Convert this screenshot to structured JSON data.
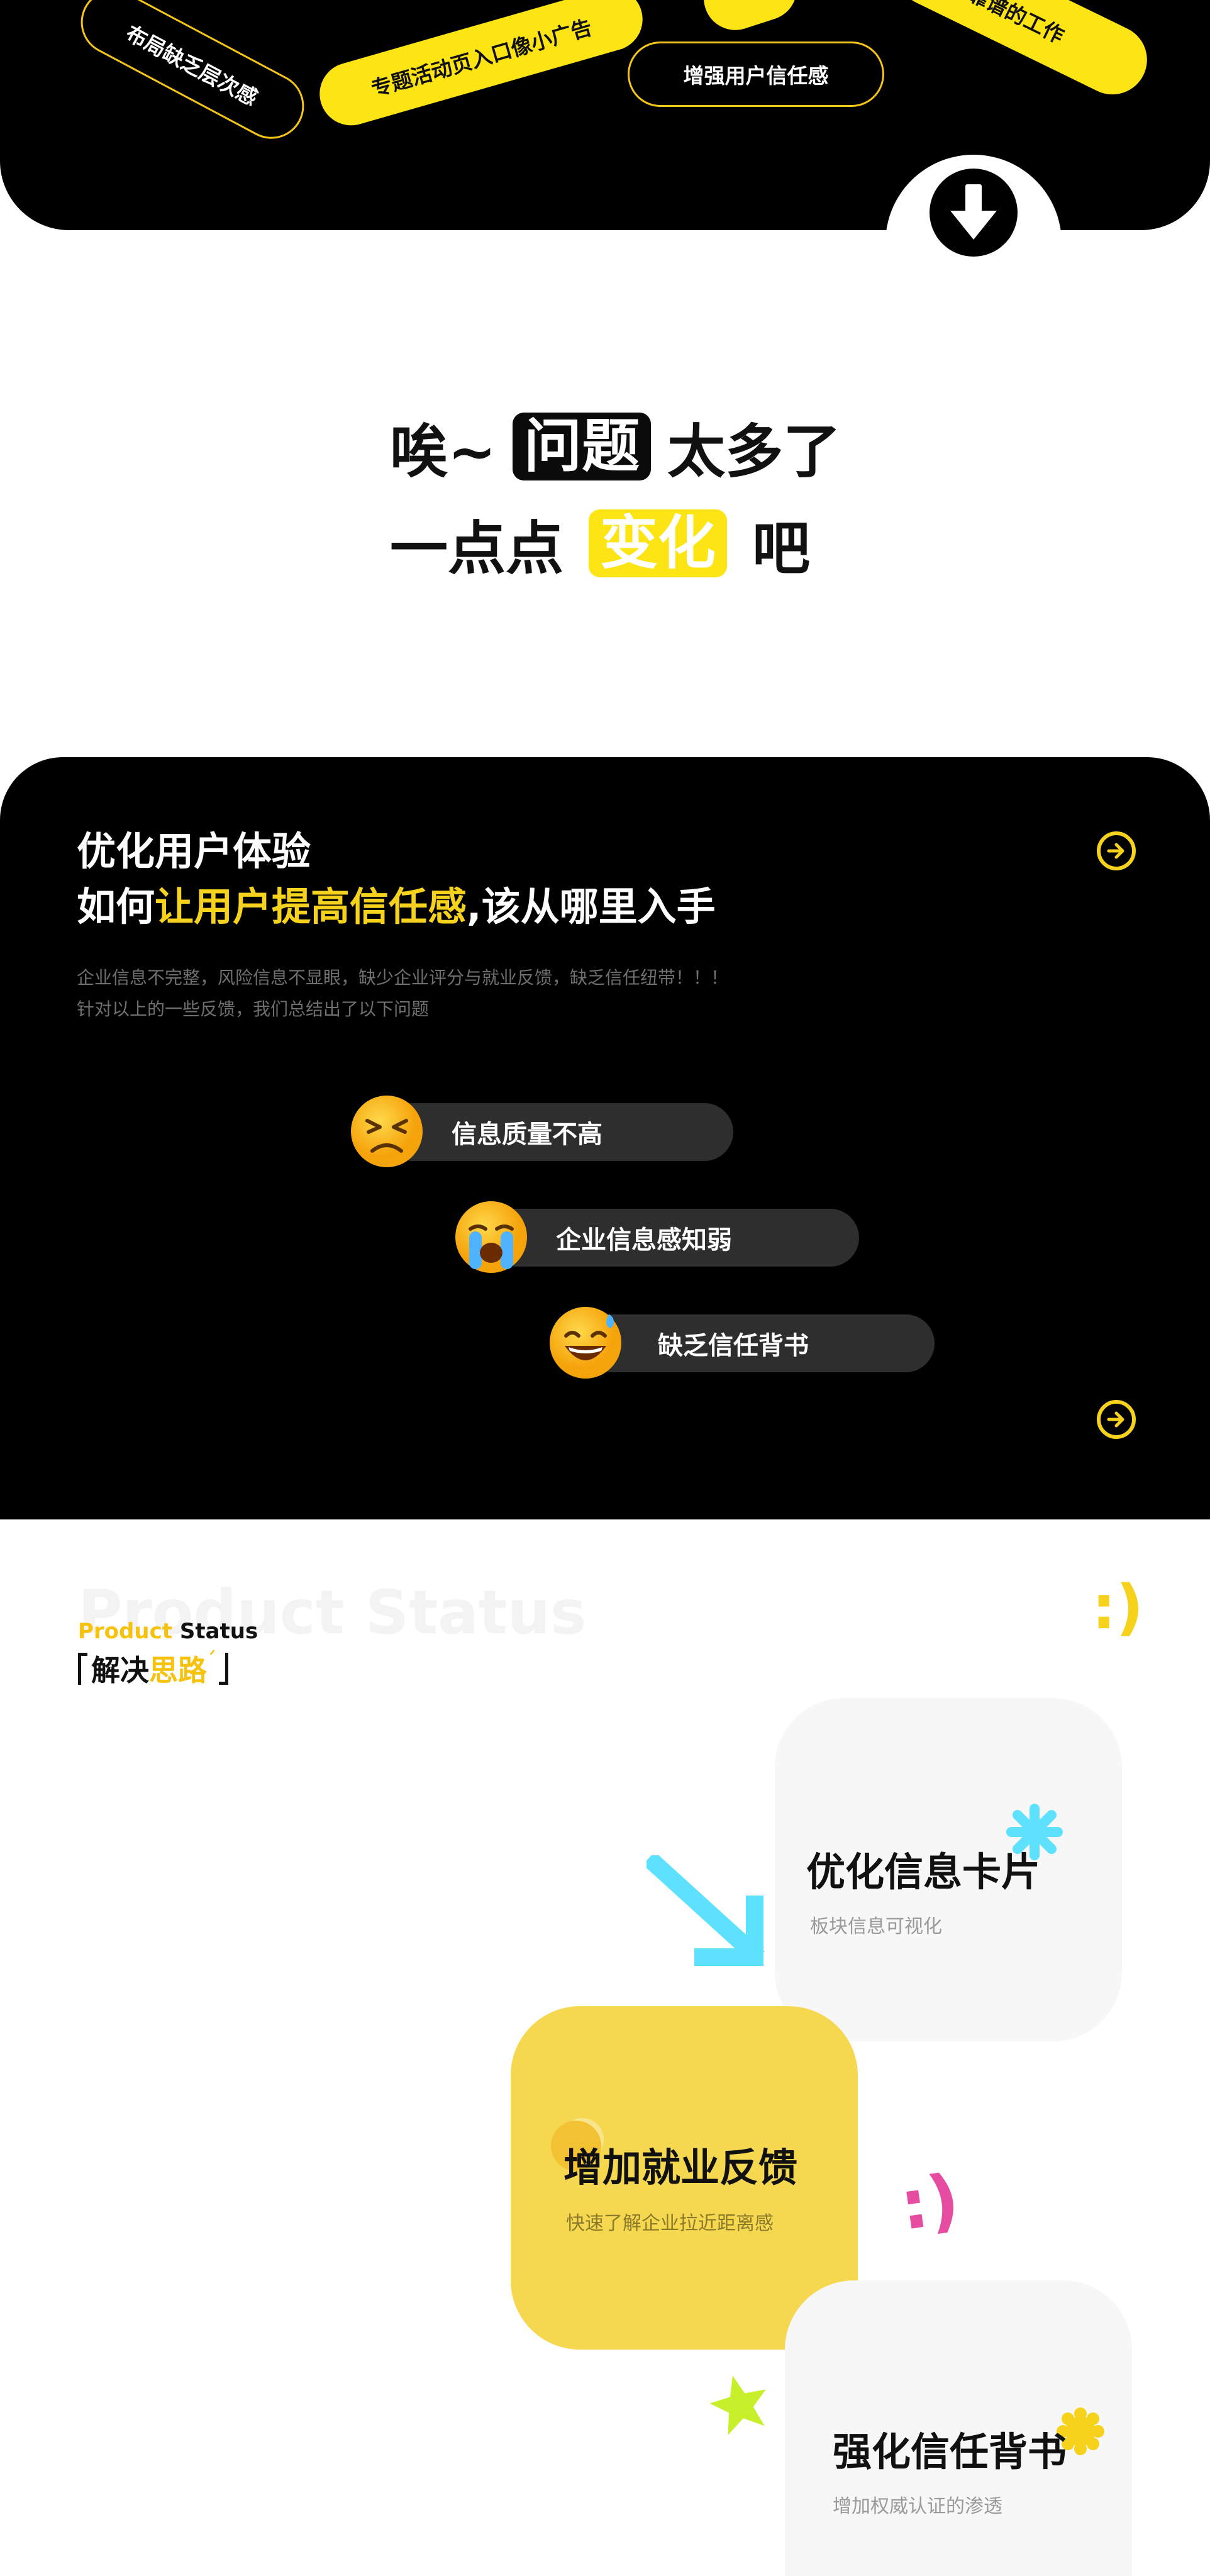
{
  "banner": {
    "tags": [
      "布局缺乏层次感",
      "专题活动页入口像小广告",
      "增强用户信任感",
      "是靠谱的工作"
    ],
    "arrow_icon": "arrow-down-icon"
  },
  "headline": {
    "line1_pre": "唉~",
    "line1_highlight": "问题",
    "line1_post": "太多了",
    "line2_pre": "一点点",
    "line2_highlight": "变化",
    "line2_post": "吧"
  },
  "problem": {
    "title_line1": "优化用户体验",
    "title_line2_pre": "如何",
    "title_line2_accent": "让用户提高信任感",
    "title_line2_post": ",该从哪里入手",
    "desc_line1": "企业信息不完整，风险信息不显眼，缺少企业评分与就业反馈，缺乏信任纽带！！！",
    "desc_line2": "针对以上的一些反馈，我们总结出了以下问题",
    "items": [
      {
        "label": "信息质量不高",
        "emoji": "persevering-face-icon"
      },
      {
        "label": "企业信息感知弱",
        "emoji": "crying-face-icon"
      },
      {
        "label": "缺乏信任背书",
        "emoji": "sweat-smile-face-icon"
      }
    ],
    "accent_color": "#f6d21c"
  },
  "solution": {
    "watermark": "Product Status",
    "label_product": "Product",
    "label_status": "Status",
    "title_pre": "解决",
    "title_accent": "思路",
    "smiley_top": ":)",
    "smiley_mid": ":)",
    "cards": [
      {
        "title": "优化信息卡片",
        "subtitle": "板块信息可视化"
      },
      {
        "title": "增加就业反馈",
        "subtitle": "快速了解企业拉近距离感"
      },
      {
        "title": "强化信任背书",
        "subtitle": "增加权威认证的渗透"
      }
    ],
    "colors": {
      "yellow": "#f6d850",
      "cyan": "#5ee0ff",
      "pink": "#e64da0",
      "lime": "#c8f02a"
    }
  }
}
